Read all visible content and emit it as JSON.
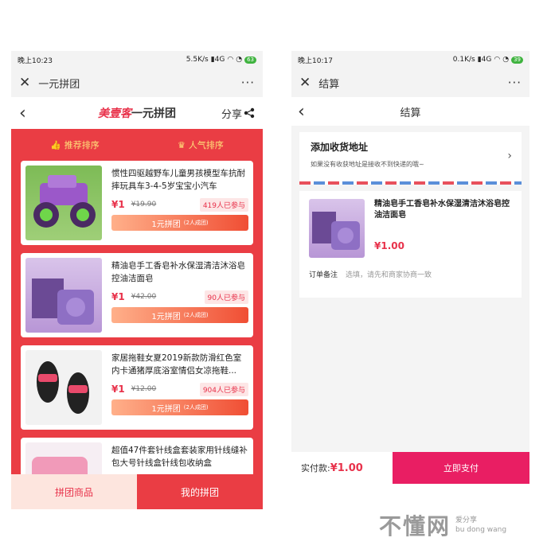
{
  "left": {
    "status": {
      "time": "晚上10:23",
      "speed": "5.5K/s",
      "battery": "63"
    },
    "topbar": {
      "title": "一元拼团",
      "more": "···"
    },
    "nav": {
      "brand_a": "美壹客",
      "brand_b": "一元拼团",
      "share": "分享"
    },
    "tabs": [
      {
        "label": "推荐排序"
      },
      {
        "label": "人气排序"
      }
    ],
    "products": [
      {
        "name": "惯性四驱越野车儿童男孩模型车抗耐摔玩具车3-4-5岁宝宝小汽车",
        "price": "¥1",
        "old": "¥19.90",
        "joined": "419人已参与",
        "btn": "1元拼团",
        "btn_small": "(2人成团)"
      },
      {
        "name": "精油皂手工香皂补水保湿清洁沐浴皂控油洁面皂",
        "price": "¥1",
        "old": "¥42.00",
        "joined": "90人已参与",
        "btn": "1元拼团",
        "btn_small": "(2人成团)"
      },
      {
        "name": "家居拖鞋女夏2019新款防滑红色室内卡通猪厚底浴室情侣女凉拖鞋...",
        "price": "¥1",
        "old": "¥12.00",
        "joined": "904人已参与",
        "btn": "1元拼团",
        "btn_small": "(2人成团)"
      },
      {
        "name": "超值47件套针线盒套装家用针线缝补包大号针线盒针线包收纳盒",
        "price": "",
        "old": "",
        "joined": "",
        "btn": "",
        "btn_small": ""
      }
    ],
    "bottom": {
      "left": "拼团商品",
      "right": "我的拼团"
    }
  },
  "right": {
    "status": {
      "time": "晚上10:17",
      "speed": "0.1K/s",
      "battery": "39"
    },
    "topbar": {
      "title": "结算",
      "more": "···"
    },
    "nav": {
      "title": "结算"
    },
    "address": {
      "title": "添加收货地址",
      "hint": "如果没有收获地址是接收不到快递的哦~"
    },
    "order": {
      "name": "精油皂手工香皂补水保湿清洁沐浴皂控油洁面皂",
      "price": "¥1.00",
      "remark_label": "订单备注",
      "remark_placeholder": "选填，请先和商家协商一致"
    },
    "pay": {
      "label": "实付款:",
      "amount": "¥1.00",
      "button": "立即支付"
    }
  },
  "watermark": {
    "big": "不懂网",
    "small1": "爱分享",
    "small2": "bu dong wang"
  }
}
